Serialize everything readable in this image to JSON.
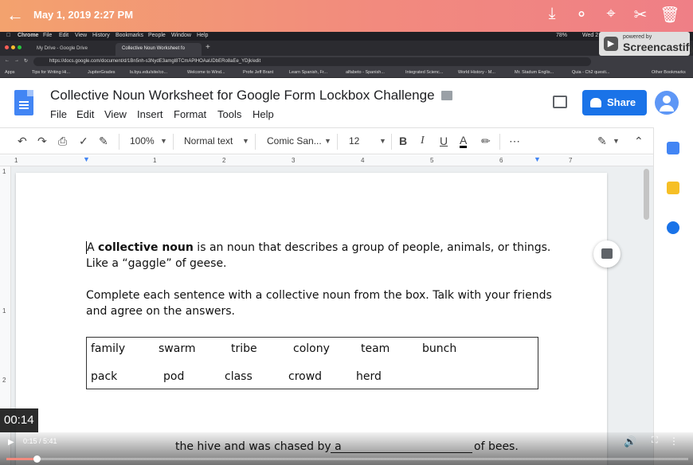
{
  "app_bar": {
    "timestamp": "May 1, 2019 2:27 PM",
    "back_icon": "arrow-left-icon",
    "actions": [
      "download-icon",
      "share-icon",
      "crop-icon",
      "scissors-icon",
      "trash-icon"
    ]
  },
  "mac_menu": {
    "items": [
      "Chrome",
      "File",
      "Edit",
      "View",
      "History",
      "Bookmarks",
      "People",
      "Window",
      "Help"
    ],
    "battery": "78%",
    "clock": "Wed 2"
  },
  "browser": {
    "tabs": [
      {
        "label": "My Drive - Google Drive"
      },
      {
        "label": "Collective Noun Worksheet fo"
      }
    ],
    "url": "https://docs.google.com/document/d/1Bn5nh-s3NydE3amgl8TCmAPlHOAaUDbERo8aEe_YDjk/edit",
    "bookmarks": [
      "Apps",
      "Tips for Writing Hi...",
      "JupiterGrades",
      "ls.byu.edu/site/co...",
      "Welcome to Wind...",
      "Profe Jeff Brant",
      "Learn Spanish, Fr...",
      "alfabeto - Spanish...",
      "Integrated Scienc...",
      "World History - M...",
      "Mr. Stadum Englis...",
      "Quia - Ch2 questi...",
      "Other Bookmarks"
    ]
  },
  "watermark": {
    "small": "powered by",
    "brand": "Screencastify"
  },
  "docs": {
    "title": "Collective Noun Worksheet for Google Form Lockbox Challenge",
    "menus": [
      "File",
      "Edit",
      "View",
      "Insert",
      "Format",
      "Tools",
      "Help"
    ],
    "share_label": "Share",
    "toolbar": {
      "zoom": "100%",
      "style": "Normal text",
      "font": "Comic San...",
      "size": "12",
      "bold": "B",
      "italic": "I",
      "underline": "U",
      "text_color": "A",
      "more": "⋯"
    },
    "ruler_numbers": [
      "1",
      "1",
      "2",
      "3",
      "4",
      "5",
      "6",
      "7"
    ],
    "vruler_numbers": [
      "1",
      "1",
      "2"
    ]
  },
  "content": {
    "intro_prefix": "A ",
    "intro_bold": "collective noun",
    "intro_rest": " is an noun that describes a group of people, animals, or things.",
    "intro_line2": "Like a “gaggle” of geese.",
    "instructions_line1": "Complete each sentence with a collective noun from the box. Talk with your friends",
    "instructions_line2": "and agree on the answers.",
    "word_box_row1": [
      "family",
      "swarm",
      "tribe",
      "colony",
      "team",
      "bunch"
    ],
    "word_box_row2": [
      "pack",
      "pod",
      "class",
      "crowd",
      "herd"
    ],
    "sentence_start": "the hive and was chased by a",
    "sentence_end": "of bees."
  },
  "video": {
    "elapsed_badge": "00:14",
    "time": "0:15 / 5:41",
    "progress": 0.044
  },
  "colors": {
    "share_button": "#1a73e8",
    "doc_icon": "#4285f4",
    "app_bar_start": "#f3a26e",
    "app_bar_end": "#ef7f86"
  }
}
